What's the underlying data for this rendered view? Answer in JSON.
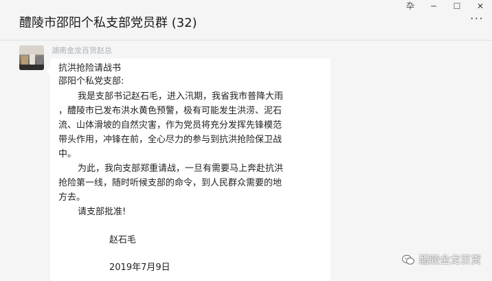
{
  "window": {
    "chat_title": "醴陵市邵阳个私支部党员群 (32)",
    "controls": {
      "pin": "卆",
      "minimize": "─",
      "maximize": "☐",
      "close": "✕"
    },
    "more_icon": "more-dots-icon",
    "more_label": "···"
  },
  "message": {
    "sender": "湖南金龙百货赵总",
    "lines": [
      "抗洪抢险请战书",
      "邵阳个私党支部:",
      "我是支部书记赵石毛，进入汛期，我省我市普降大雨",
      "，醴陵市已发布洪水黄色预警，极有可能发生洪涝、泥石",
      "流、山体滑坡的自然灾害，作为党员将充分发挥先锋模范",
      "带头作用，冲锋在前，全心尽力的参与到抗洪抢险保卫战",
      "中。",
      "为此，我向支部郑重请战，一旦有需要马上奔赴抗洪",
      "抢险第一线，随时听候支部的命令，到人民群众需要的地",
      "方去。",
      "请支部批准!",
      "赵石毛",
      "2019年7月9日"
    ]
  },
  "watermark": {
    "text": "醴陵金龙百货",
    "icon": "wechat-icon"
  }
}
